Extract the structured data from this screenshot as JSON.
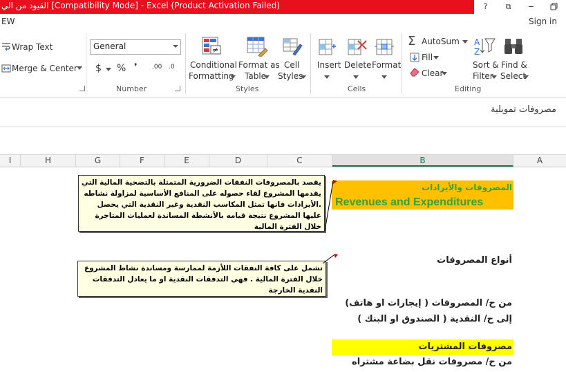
{
  "titlebar": {
    "text": "القيود من الي  [Compatibility Mode] -  Excel (Product Activation Failed)",
    "buttons": [
      "?",
      "⧉",
      "−"
    ]
  },
  "tabs": {
    "partial_tab": "EW",
    "sign_in": "Sign in"
  },
  "ribbon": {
    "alignment": {
      "wrap_text": "Wrap Text",
      "merge_center": "Merge & Center"
    },
    "number": {
      "format_value": "General",
      "currency": "$",
      "percent": "%",
      "comma": "❜",
      "inc_decimal": ".00",
      "dec_decimal": ".0",
      "group_label": "Number"
    },
    "styles": {
      "conditional": [
        "Conditional",
        "Formatting"
      ],
      "format_table": [
        "Format as",
        "Table"
      ],
      "cell_styles": [
        "Cell",
        "Styles"
      ],
      "group_label": "Styles"
    },
    "cells": {
      "insert": "Insert",
      "delete": "Delete",
      "format": "Format",
      "group_label": "Cells"
    },
    "editing": {
      "autosum": "AutoSum",
      "fill": "Fill",
      "clear": "Clear",
      "sort": [
        "Sort &",
        "Filter"
      ],
      "find": [
        "Find &",
        "Select"
      ],
      "group_label": "Editing"
    }
  },
  "formula_bar": {
    "content": "مصروفات تمويلية"
  },
  "columns": [
    "I",
    "H",
    "G",
    "F",
    "E",
    "D",
    "C",
    "B",
    "A"
  ],
  "sheet": {
    "b_heading_ar": "المصروفات والأيرادات",
    "b_heading_en": "Revenues and Expenditures",
    "types_label": "أنواع المصروفات",
    "entry1_line1": "من ح/ المصروفات ( إيجارات او هاتف)",
    "entry1_line2": "إلى ح/ النقدية ( الصندوق او البنك )",
    "purchases_label": "مصروفات المشتريات",
    "entry2_line1": "من ح/ مصروفات نقل بضاعة مشتراه"
  },
  "comments": {
    "comment1": "يقصد بالمصروفات النفقات الضرورية المتمثلة بالتضحية المالية التي يقدمها المشروع لقاء حصوله على المنافع الأساسية لمزاولة نشاطه .الأيرادات فانها تمثل المكاسب النقدية وغير النقدية التي يحصل عليها المشروع نتيجة قيامه بالأنشطة المساندة لعمليات المتاجرة خلال الفترة المالية",
    "comment2": "تشمل على كافة النفقات اللأزمة لممارسة ومساندة نشاط المشروع خلال الفترة المالية . فهي التدفقات النقدية او ما يعادل التدفقات النقدية الخارجة"
  },
  "colors": {
    "title_red": "#e8101c",
    "heading_fill": "#ffc000",
    "heading_text": "#3aa036",
    "purchases_fill": "#ffff00",
    "comment_fill": "#ffffe1",
    "excel_green": "#217346"
  },
  "icons": {
    "wrap": "wrap-text-icon",
    "merge": "merge-center-icon",
    "conditional": "conditional-formatting-icon",
    "table": "format-as-table-icon",
    "cellstyles": "cell-styles-icon",
    "insert": "insert-cells-icon",
    "delete": "delete-cells-icon",
    "format": "format-cells-icon",
    "autosum": "autosum-icon",
    "fill": "fill-icon",
    "clear": "eraser-icon",
    "sort": "sort-filter-icon",
    "find": "binoculars-icon"
  }
}
